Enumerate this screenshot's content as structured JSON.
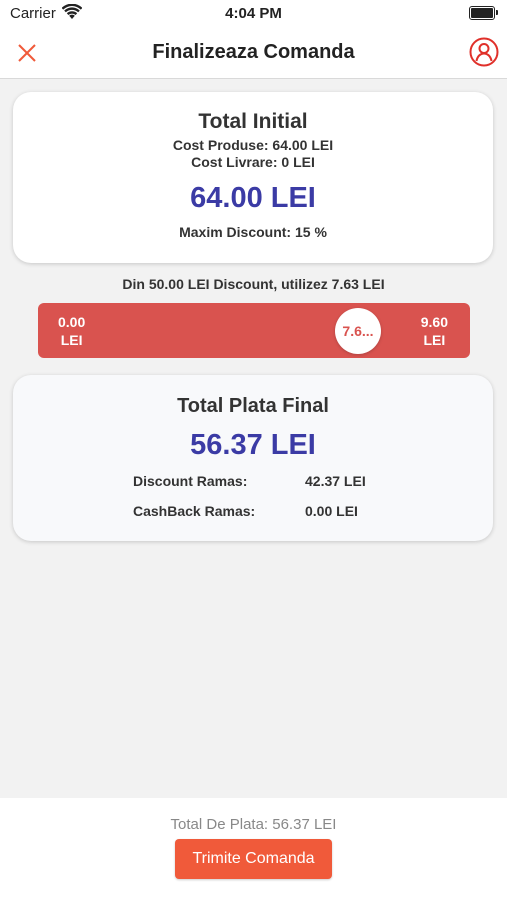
{
  "status_bar": {
    "carrier": "Carrier",
    "time": "4:04 PM"
  },
  "nav": {
    "title": "Finalizeaza Comanda"
  },
  "initial_card": {
    "heading": "Total Initial",
    "cost_produse": "Cost Produse: 64.00 LEI",
    "cost_livrare": "Cost Livrare: 0 LEI",
    "amount": "64.00 LEI",
    "max_discount": "Maxim Discount: 15 %"
  },
  "discount_line": "Din 50.00 LEI Discount, utilizez 7.63 LEI",
  "slider": {
    "min_value": "0.00",
    "min_unit": "LEI",
    "max_value": "9.60",
    "max_unit": "LEI",
    "thumb_label": "7.6...",
    "current_value": 7.63,
    "color": "#d9534f"
  },
  "final_card": {
    "heading": "Total Plata Final",
    "amount": "56.37 LEI",
    "discount_label": "Discount Ramas:",
    "discount_value": "42.37 LEI",
    "cashback_label": "CashBack Ramas:",
    "cashback_value": "0.00 LEI"
  },
  "footer": {
    "total": "Total De Plata: 56.37 LEI",
    "submit_label": "Trimite Comanda",
    "button_color": "#f05a3a"
  },
  "icons": {
    "close": "close-icon",
    "profile": "user-profile-icon",
    "wifi": "wifi-icon",
    "battery": "battery-icon"
  },
  "colors": {
    "accent": "#f05a3a",
    "amount": "#3b3ba5"
  }
}
